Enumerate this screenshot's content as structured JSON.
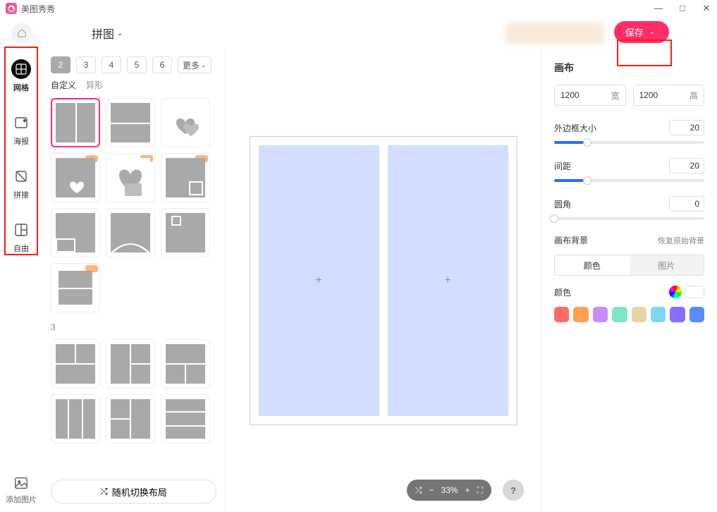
{
  "app": {
    "name": "美图秀秀"
  },
  "window_controls": {
    "min": "—",
    "max": "□",
    "close": "✕"
  },
  "topbar": {
    "mode_label": "拼图",
    "save_label": "保存"
  },
  "leftnav": {
    "items": [
      {
        "key": "grid",
        "label": "网格"
      },
      {
        "key": "poster",
        "label": "海报"
      },
      {
        "key": "stitch",
        "label": "拼接"
      },
      {
        "key": "free",
        "label": "自由"
      }
    ],
    "add_pic_label": "添加图片"
  },
  "template_panel": {
    "count_tabs": [
      "2",
      "3",
      "4",
      "5",
      "6"
    ],
    "more_label": "更多",
    "active_count": "2",
    "subcats": [
      "自定义",
      "异形"
    ],
    "section3_label": "3",
    "random_label": "随机切换布局"
  },
  "canvas": {
    "zoom_label": "33%"
  },
  "right_panel": {
    "title": "画布",
    "width_value": "1200",
    "width_unit": "宽",
    "height_value": "1200",
    "height_unit": "高",
    "sliders": {
      "border": {
        "label": "外边框大小",
        "value": "20",
        "pct": 22
      },
      "gap": {
        "label": "间距",
        "value": "20",
        "pct": 22
      },
      "radius": {
        "label": "圆角",
        "value": "0",
        "pct": 0
      }
    },
    "bg_label": "画布背景",
    "bg_reset": "恢复原始背景",
    "bg_tabs": {
      "color": "颜色",
      "image": "图片"
    },
    "color_label": "颜色",
    "swatches": [
      "#ff6b6b",
      "#ffa052",
      "#c98cff",
      "#7ee6c7",
      "#e6d6a3",
      "#7cd9f5",
      "#8c6bff",
      "#5a8cff"
    ]
  }
}
